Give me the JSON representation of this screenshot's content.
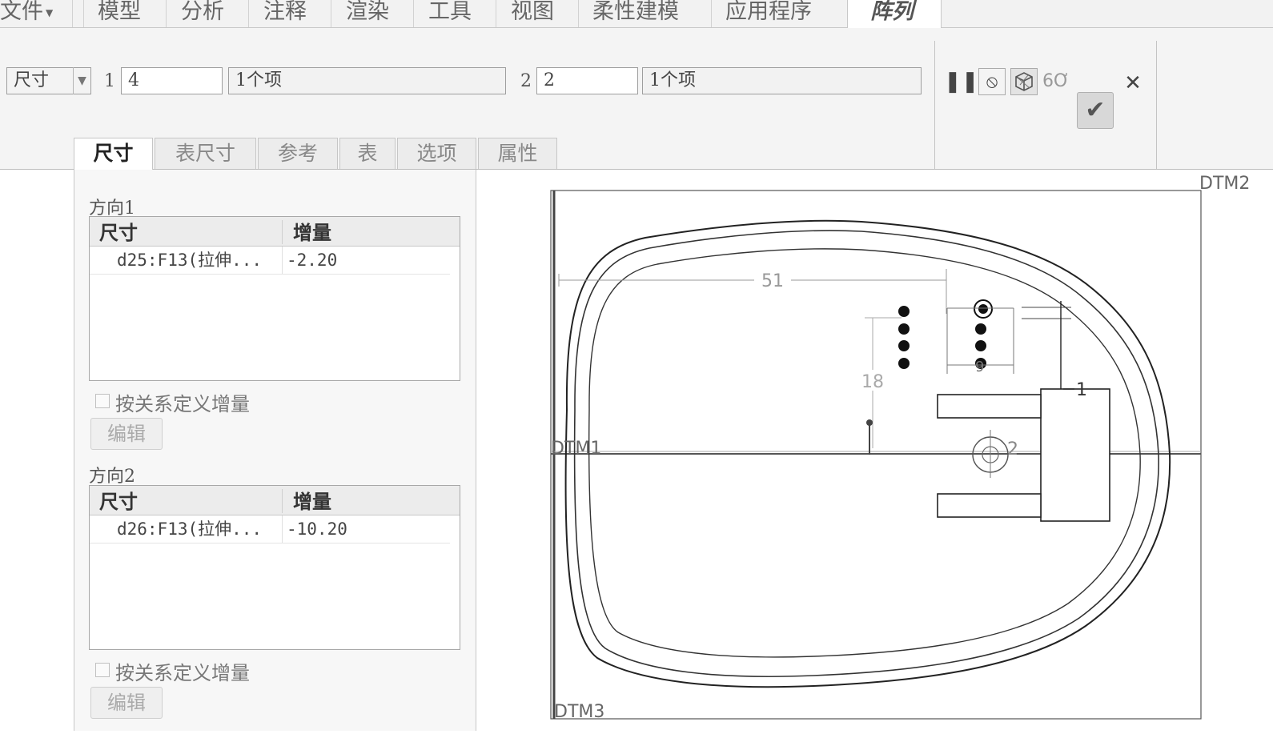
{
  "menu": {
    "items": [
      "文件",
      "模型",
      "分析",
      "注释",
      "渲染",
      "工具",
      "视图",
      "柔性建模",
      "应用程序"
    ],
    "active": "阵列"
  },
  "dashboard": {
    "type_select": "尺寸",
    "dir1_label": "1",
    "dir1_count": "4",
    "dir1_items": "1个项",
    "dir2_label": "2",
    "dir2_count": "2",
    "dir2_items": "1个项"
  },
  "tools": {
    "pause": "pause-icon",
    "no_preview": "no-preview-icon",
    "preview": "preview-geometry-icon",
    "verify": "glasses-icon",
    "ok": "checkmark-icon",
    "cancel": "close-icon"
  },
  "subtabs": [
    "尺寸",
    "表尺寸",
    "参考",
    "表",
    "选项",
    "属性"
  ],
  "panel": {
    "dir1": {
      "title": "方向1",
      "columns": [
        "尺寸",
        "增量"
      ],
      "rows": [
        {
          "dim": "d25:F13(拉伸...",
          "inc": "-2.20"
        }
      ],
      "relation_label": "按关系定义增量",
      "edit_label": "编辑"
    },
    "dir2": {
      "title": "方向2",
      "columns": [
        "尺寸",
        "增量"
      ],
      "rows": [
        {
          "dim": "d26:F13(拉伸...",
          "inc": "-10.20"
        }
      ],
      "relation_label": "按关系定义增量",
      "edit_label": "编辑"
    }
  },
  "drawing": {
    "datums": [
      "DTM2",
      "DTM1",
      "DTM3"
    ],
    "dims": [
      "51",
      "18",
      "9",
      "1",
      "2"
    ]
  }
}
